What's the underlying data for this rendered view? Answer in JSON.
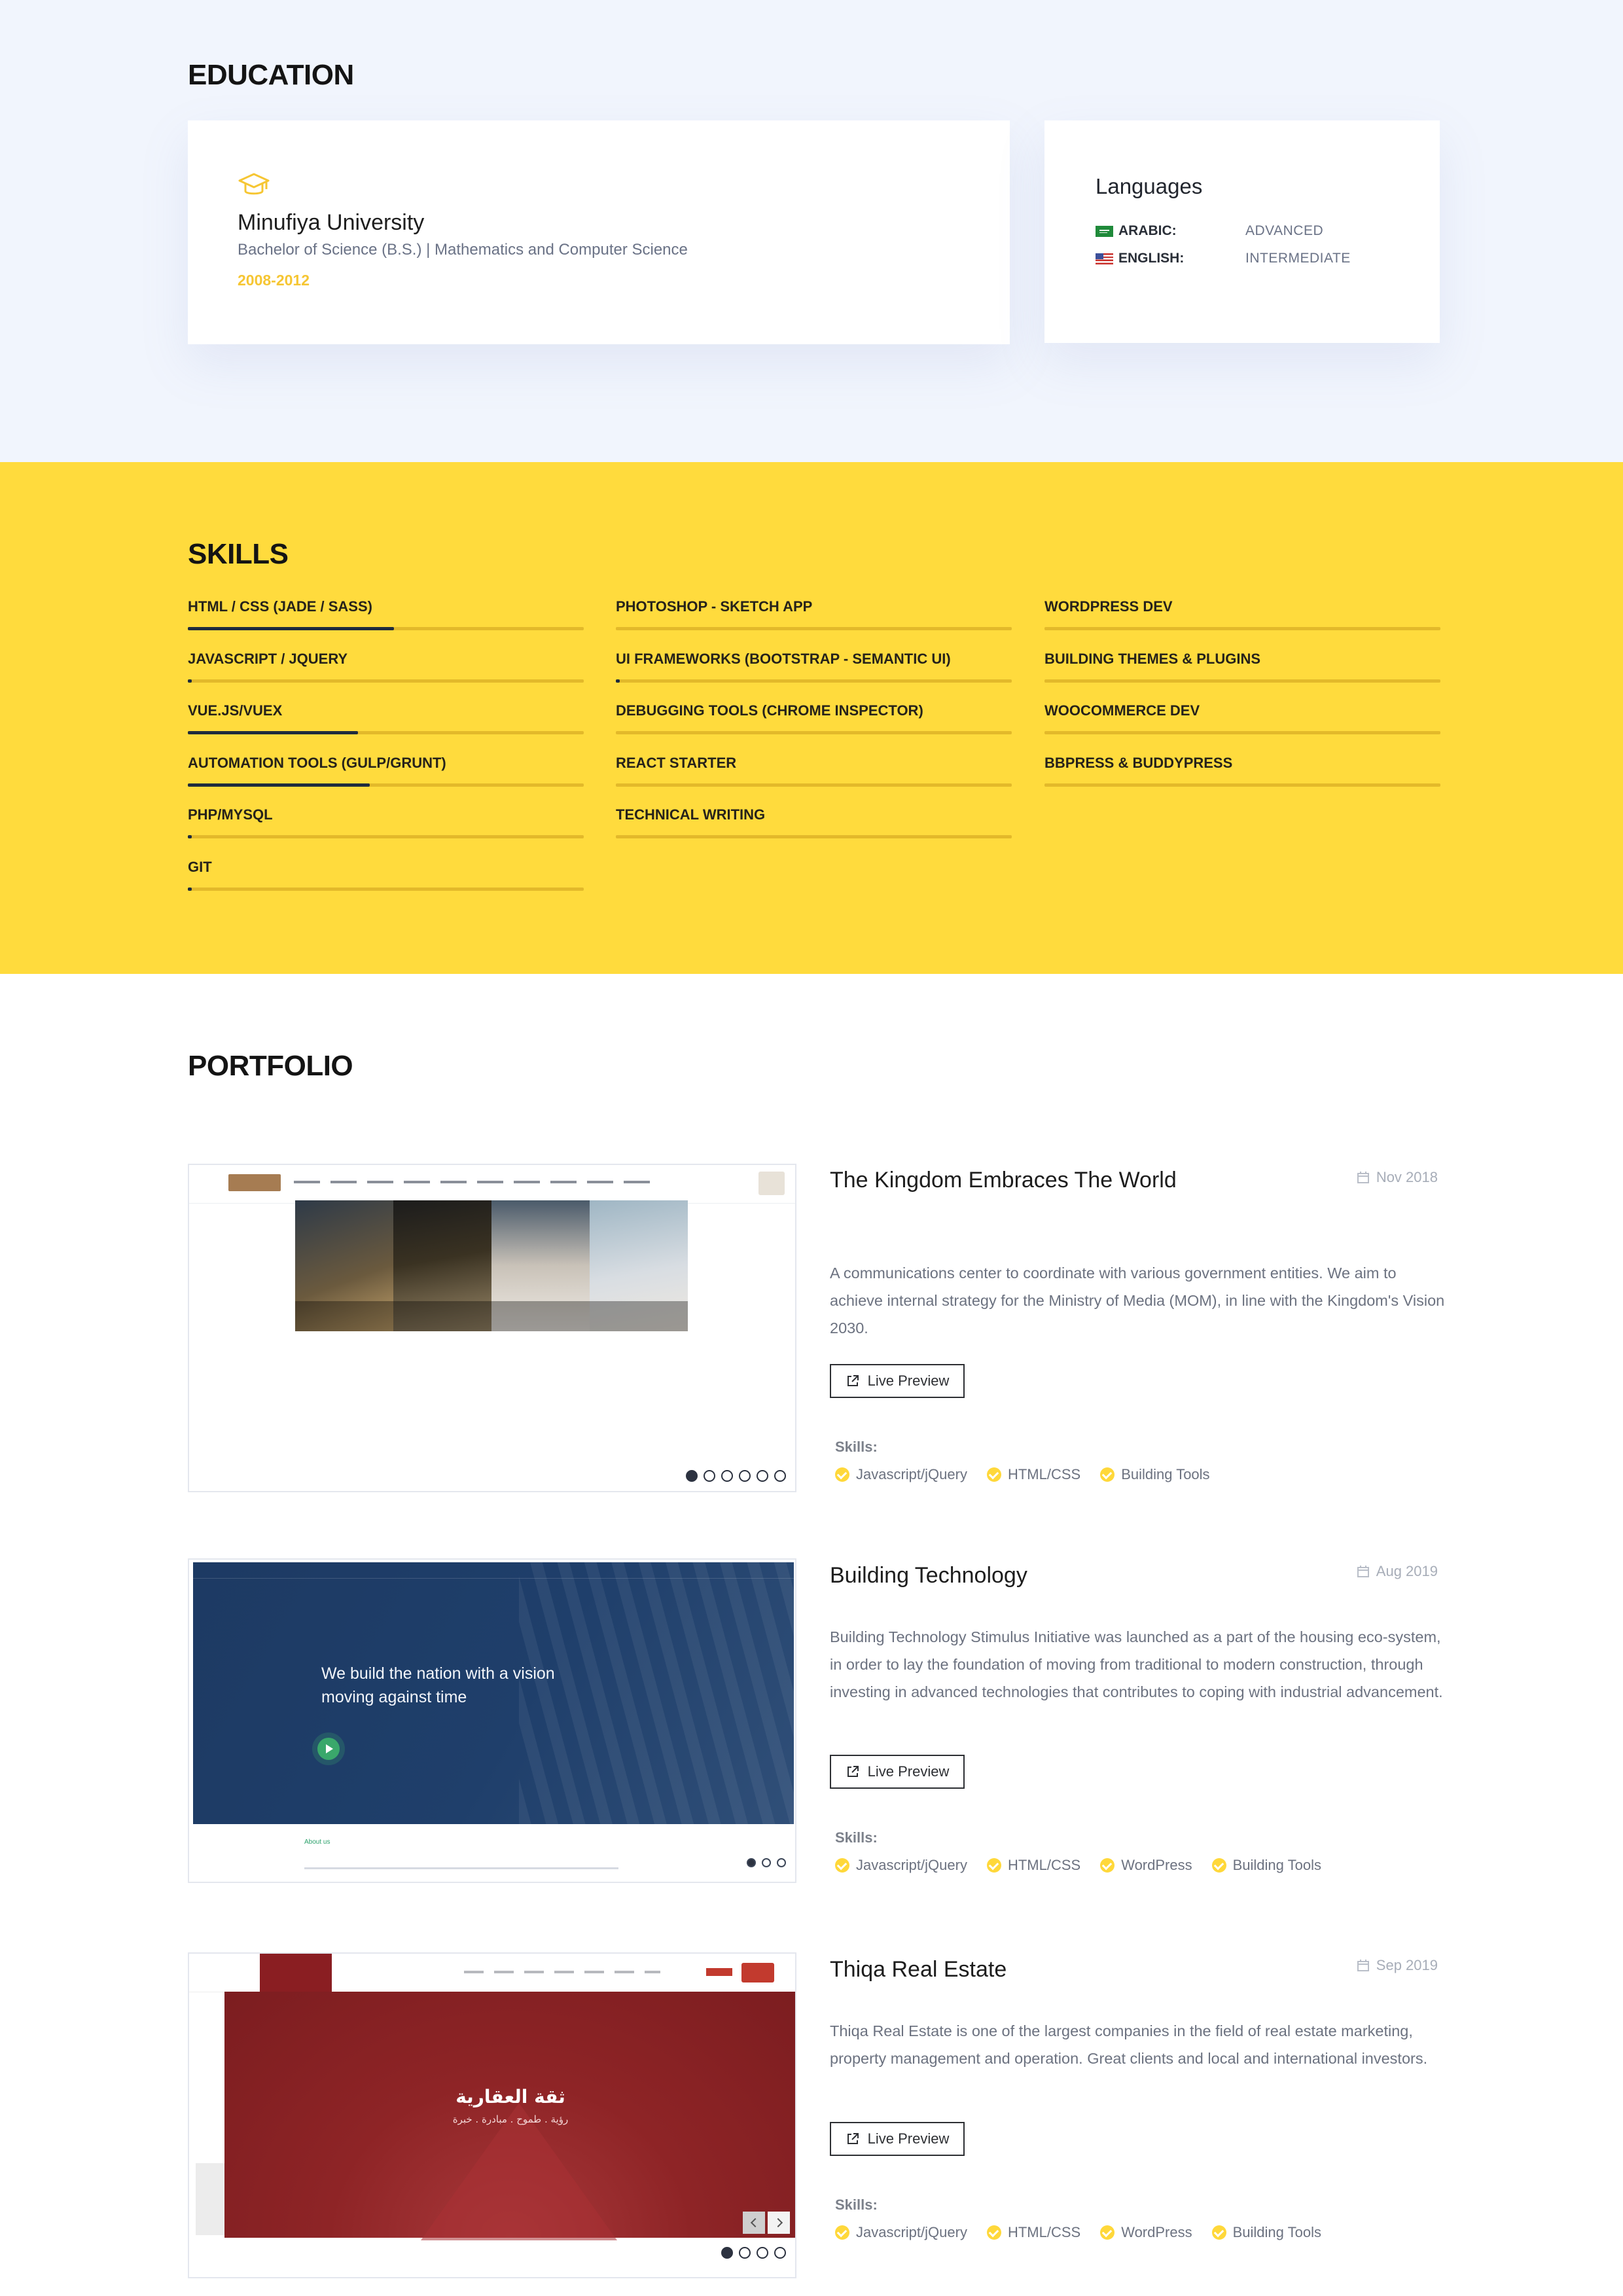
{
  "education": {
    "section_title": "EDUCATION",
    "university": "Minufiya University",
    "degree": "Bachelor of Science (B.S.) | Mathematics and Computer Science",
    "years": "2008-2012",
    "icon": "graduation-cap-icon",
    "accent_color": "#f6c633"
  },
  "languages": {
    "title": "Languages",
    "items": [
      {
        "flag": "saudi-flag-icon",
        "name": "ARABIC:",
        "level": "ADVANCED"
      },
      {
        "flag": "us-flag-icon",
        "name": "ENGLISH:",
        "level": "INTERMEDIATE"
      }
    ]
  },
  "skills": {
    "section_title": "SKILLS",
    "background_color": "#ffdb3d",
    "columns": [
      [
        {
          "label": "HTML / CSS (JADE / SASS)",
          "level": 0.52
        },
        {
          "label": "JAVASCRIPT / JQUERY",
          "level": 0.01
        },
        {
          "label": "VUE.JS/VUEX",
          "level": 0.43
        },
        {
          "label": "AUTOMATION TOOLS (GULP/GRUNT)",
          "level": 0.46
        },
        {
          "label": "PHP/MYSQL",
          "level": 0.01
        },
        {
          "label": "GIT",
          "level": 0.01
        }
      ],
      [
        {
          "label": "PHOTOSHOP - SKETCH APP",
          "level": 0.0
        },
        {
          "label": "UI FRAMEWORKS (BOOTSTRAP - SEMANTIC UI)",
          "level": 0.01
        },
        {
          "label": "DEBUGGING TOOLS (CHROME INSPECTOR)",
          "level": 0.0
        },
        {
          "label": "REACT STARTER",
          "level": 0.0
        },
        {
          "label": "TECHNICAL WRITING",
          "level": 0.0
        }
      ],
      [
        {
          "label": "WORDPRESS DEV",
          "level": 0.0
        },
        {
          "label": "BUILDING THEMES & PLUGINS",
          "level": 0.0
        },
        {
          "label": "WOOCOMMERCE DEV",
          "level": 0.0
        },
        {
          "label": "BBPRESS & BUDDYPRESS",
          "level": 0.0
        }
      ]
    ]
  },
  "portfolio": {
    "section_title": "PORTFOLIO",
    "button_label": "Live Preview",
    "skills_label": "Skills:",
    "projects": [
      {
        "title": "The Kingdom Embraces The World",
        "date": "Nov 2018",
        "description": "A communications center to coordinate with various government entities. We aim to achieve internal strategy for the Ministry of Media (MOM), in line with the Kingdom's Vision 2030.",
        "skills": [
          "Javascript/jQuery",
          "HTML/CSS",
          "Building Tools"
        ],
        "slides": 6,
        "active_slide": 1
      },
      {
        "title": "Building Technology",
        "date": "Aug 2019",
        "description": "Building Technology Stimulus Initiative was launched as a part of the housing eco-system, in order to lay the foundation of moving from traditional to modern construction, through investing in advanced technologies that contributes to coping with industrial advancement.",
        "skills": [
          "Javascript/jQuery",
          "HTML/CSS",
          "WordPress",
          "Building Tools"
        ],
        "hero_text": "We build the nation with a vision moving against time",
        "about_label": "About us",
        "slides": 3,
        "active_slide": 1
      },
      {
        "title": "Thiqa Real Estate",
        "date": "Sep 2019",
        "description": "Thiqa Real Estate is one of the largest companies in the field of real estate marketing, property management and operation. Great clients and local and international investors.",
        "skills": [
          "Javascript/jQuery",
          "HTML/CSS",
          "WordPress",
          "Building Tools"
        ],
        "hero_text": "ثقة العقارية",
        "hero_sub": "رؤية . طموح . مبادرة . خبرة",
        "slides": 4,
        "active_slide": 1
      }
    ]
  }
}
